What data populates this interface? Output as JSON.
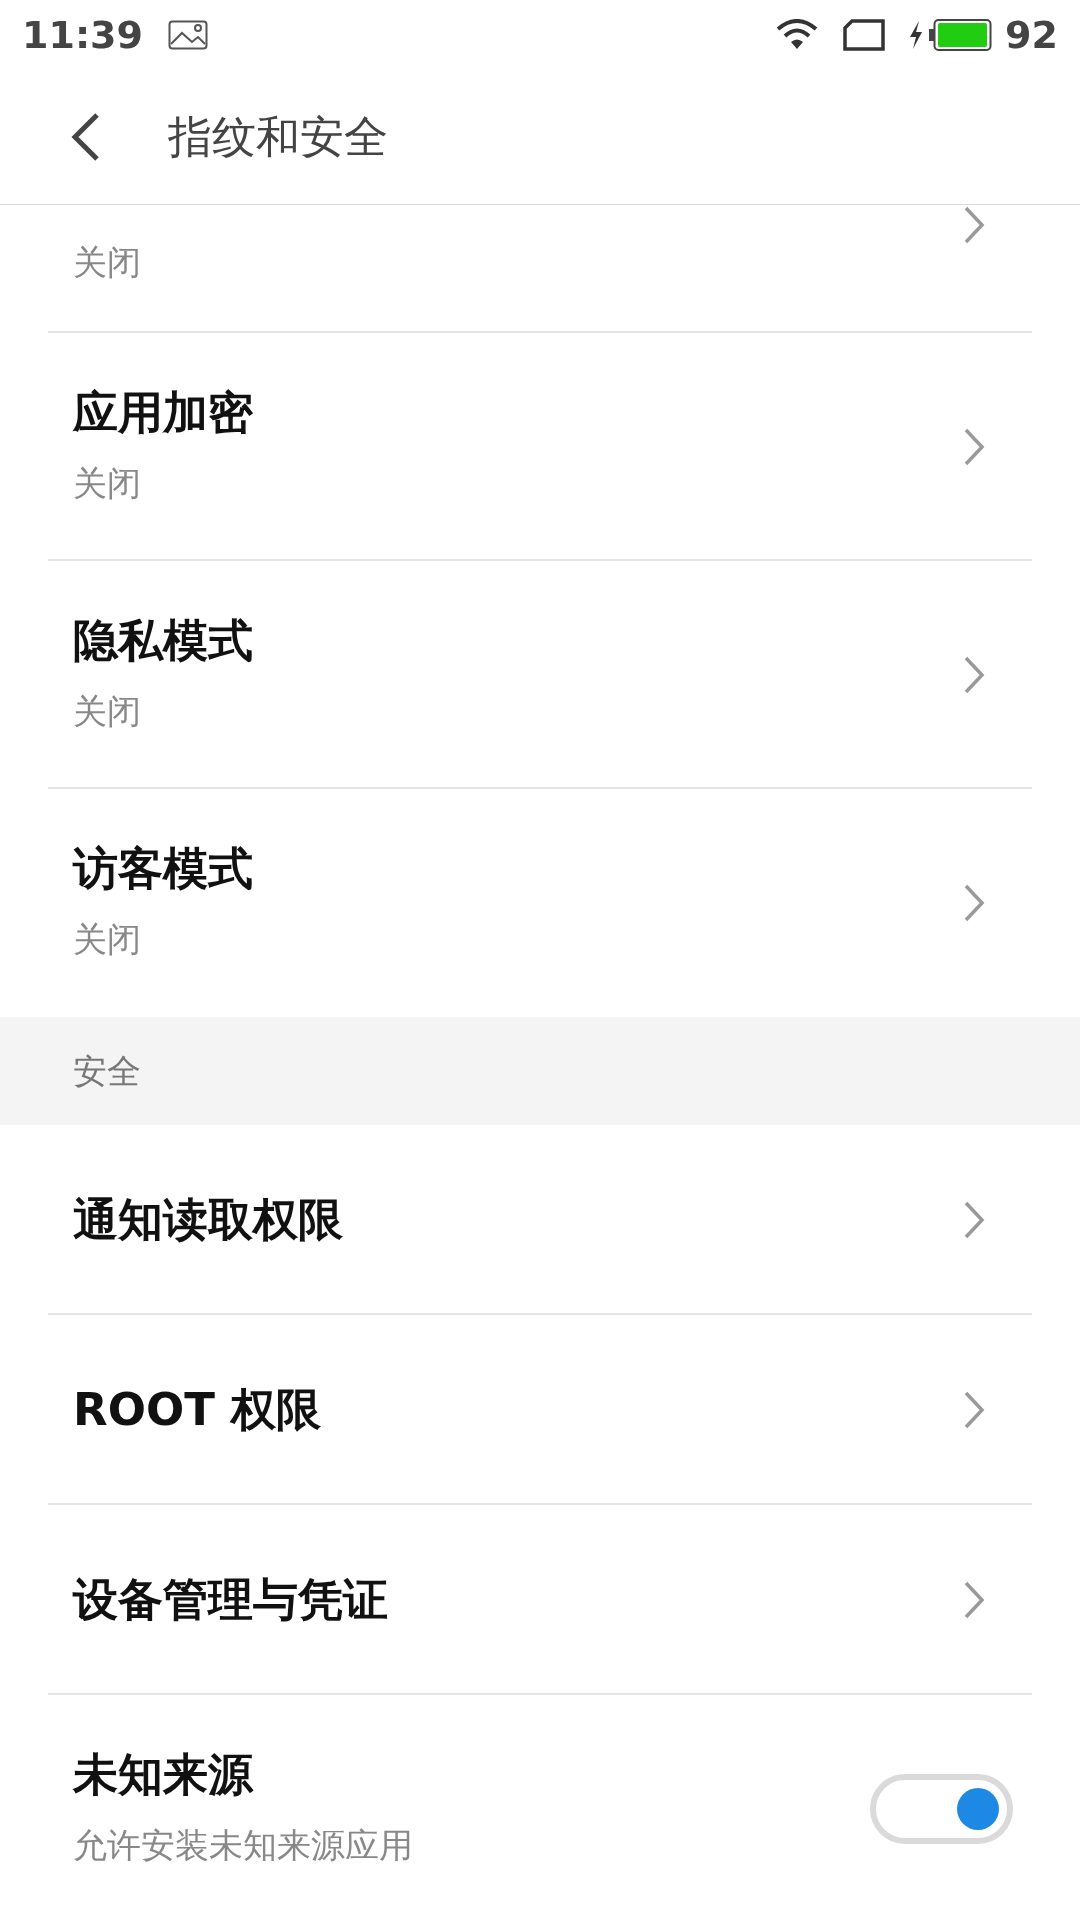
{
  "status_bar": {
    "time": "11:39",
    "battery": "92"
  },
  "header": {
    "title": "指纹和安全"
  },
  "rows": [
    {
      "kind": "partial",
      "subtitle": "关闭"
    },
    {
      "kind": "link",
      "title": "应用加密",
      "subtitle": "关闭"
    },
    {
      "kind": "link",
      "title": "隐私模式",
      "subtitle": "关闭"
    },
    {
      "kind": "link",
      "title": "访客模式",
      "subtitle": "关闭"
    },
    {
      "kind": "section",
      "title": "安全"
    },
    {
      "kind": "link",
      "title": "通知读取权限"
    },
    {
      "kind": "link",
      "title": "ROOT 权限"
    },
    {
      "kind": "link",
      "title": "设备管理与凭证"
    },
    {
      "kind": "toggle",
      "title": "未知来源",
      "subtitle": "允许安装未知来源应用",
      "on": true
    }
  ]
}
